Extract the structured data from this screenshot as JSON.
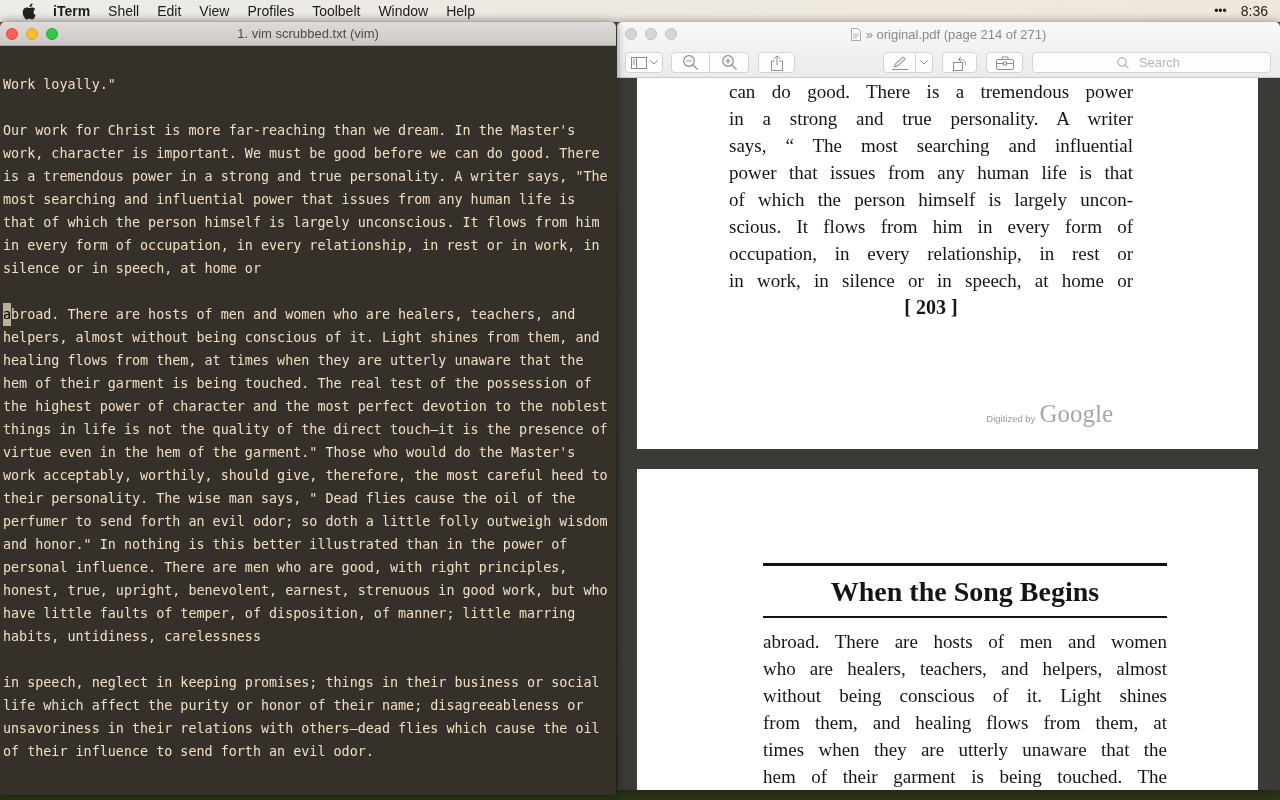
{
  "menu_bar": {
    "app_name": "iTerm",
    "menus": [
      "Shell",
      "Edit",
      "View",
      "Profiles",
      "Toolbelt",
      "Window",
      "Help"
    ],
    "status_items": [
      "•••"
    ],
    "clock": "8:36"
  },
  "terminal_window": {
    "title": "1. vim scrubbed.txt (vim)",
    "active": true,
    "paragraphs": [
      {
        "cursor": false,
        "lines": [
          "Work loyally.\""
        ]
      },
      {
        "cursor": false,
        "lines": [
          "Our work for Christ is more far-reaching than we dream. In the Master's",
          "work, character is important. We must be good before we can do good. There",
          "is a tremendous power in a strong and true personality. A writer says, \"The",
          "most searching and influential power that issues from any human life is",
          "that of which the person himself is largely unconscious. It flows from him",
          "in every form of occupation, in every relationship, in rest or in work, in",
          "silence or in speech, at home or"
        ]
      },
      {
        "cursor": true,
        "lines": [
          "abroad. There are hosts of men and women who are healers, teachers, and",
          "helpers, almost without being conscious of it. Light shines from them, and",
          "healing flows from them, at times when they are utterly unaware that the",
          "hem of their garment is being touched. The real test of the possession of",
          "the highest power of character and the most perfect devotion to the noblest",
          "things in life is not the quality of the direct touch—it is the presence of",
          "virtue even in the hem of the garment.\" Those who would do the Master's",
          "work acceptably, worthily, should give, therefore, the most careful heed to",
          "their personality. The wise man says, \" Dead flies cause the oil of the",
          "perfumer to send forth an evil odor; so doth a little folly outweigh wisdom",
          "and honor.\" In nothing is this better illustrated than in the power of",
          "personal influence. There are men who are good, with right principles,",
          "honest, true, upright, benevolent, earnest, strenuous in good work, but who",
          "have little faults of temper, of disposition, of manner; little marring",
          "habits, untidiness, carelessness"
        ]
      },
      {
        "cursor": false,
        "lines": [
          "in speech, neglect in keeping promises; things in their business or social",
          "life which affect the purity or honor of their name; disagreeableness or",
          "unsavoriness in their relations with others—dead flies which cause the oil",
          "of their influence to send forth an evil odor."
        ]
      }
    ]
  },
  "preview_window": {
    "title": "» original.pdf (page 214 of 271)",
    "active": false,
    "search": {
      "placeholder": "Search"
    },
    "pages": [
      {
        "kind": "text",
        "lines": [
          "can do good. There is a tremendous power",
          "in a strong and true personality. A writer",
          "says, “ The most searching and influential",
          "power that issues from any human life is that",
          "of which the person himself is largely uncon-",
          "scious. It flows from him in every form of",
          "occupation, in every relationship, in rest or",
          "in work, in silence or in speech, at home or"
        ],
        "page_number": "[ 203 ]",
        "digitized_by": "Digitized by",
        "digitizer": "Google"
      },
      {
        "kind": "chapter_opening",
        "heading": "When the Song Begins",
        "lines": [
          "abroad. There are hosts of men and women",
          "who are healers, teachers, and helpers, almost",
          "without being conscious of it. Light shines",
          "from them, and healing flows from them, at",
          "times when they are utterly unaware that the",
          "hem of their garment is being touched. The"
        ]
      }
    ]
  }
}
